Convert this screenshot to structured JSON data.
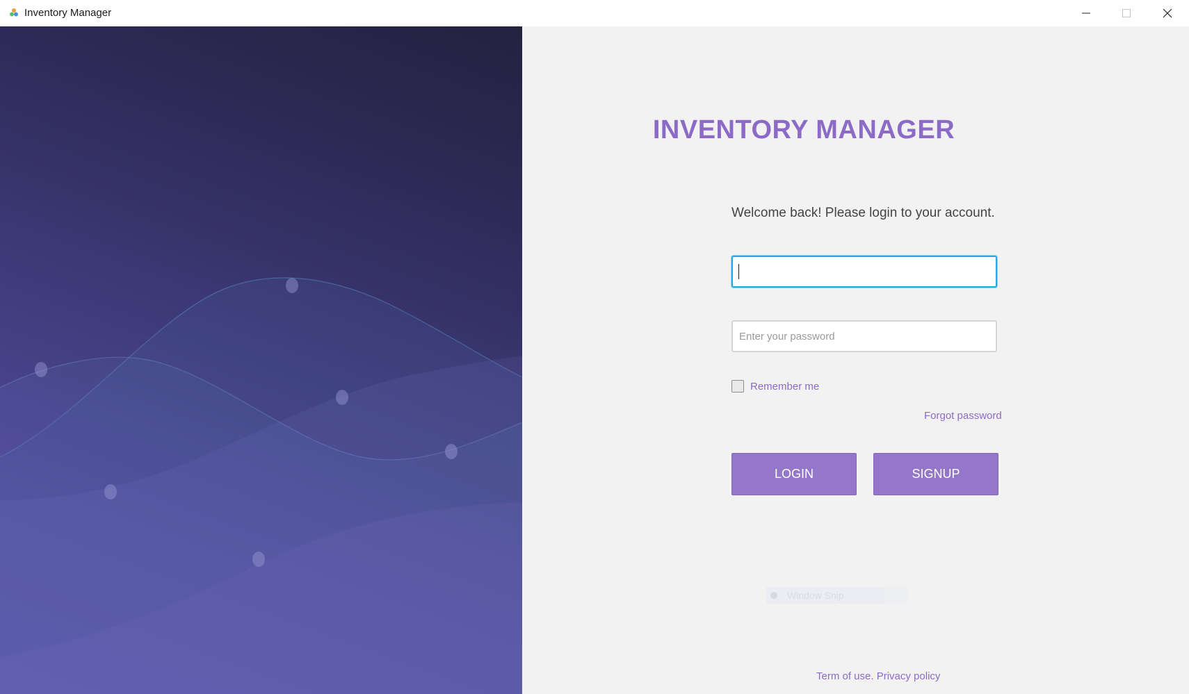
{
  "window": {
    "title": "Inventory Manager"
  },
  "login": {
    "heading": "INVENTORY MANAGER",
    "welcome": "Welcome back! Please login to your account.",
    "username_value": "",
    "password_placeholder": "Enter your password",
    "remember_label": "Remember me",
    "remember_checked": false,
    "forgot_label": "Forgot password",
    "login_label": "LOGIN",
    "signup_label": "SIGNUP"
  },
  "overlay": {
    "snip_label": "Window Snip"
  },
  "footer": {
    "terms_label": "Term of use.",
    "privacy_label": "Privacy policy"
  },
  "colors": {
    "accent": "#8c6bc6",
    "button": "#9577c9",
    "focus": "#2aa6e0"
  },
  "icons": {
    "app": "app-logo-icon",
    "minimize": "minimize-icon",
    "maximize": "maximize-icon",
    "close": "close-icon"
  }
}
